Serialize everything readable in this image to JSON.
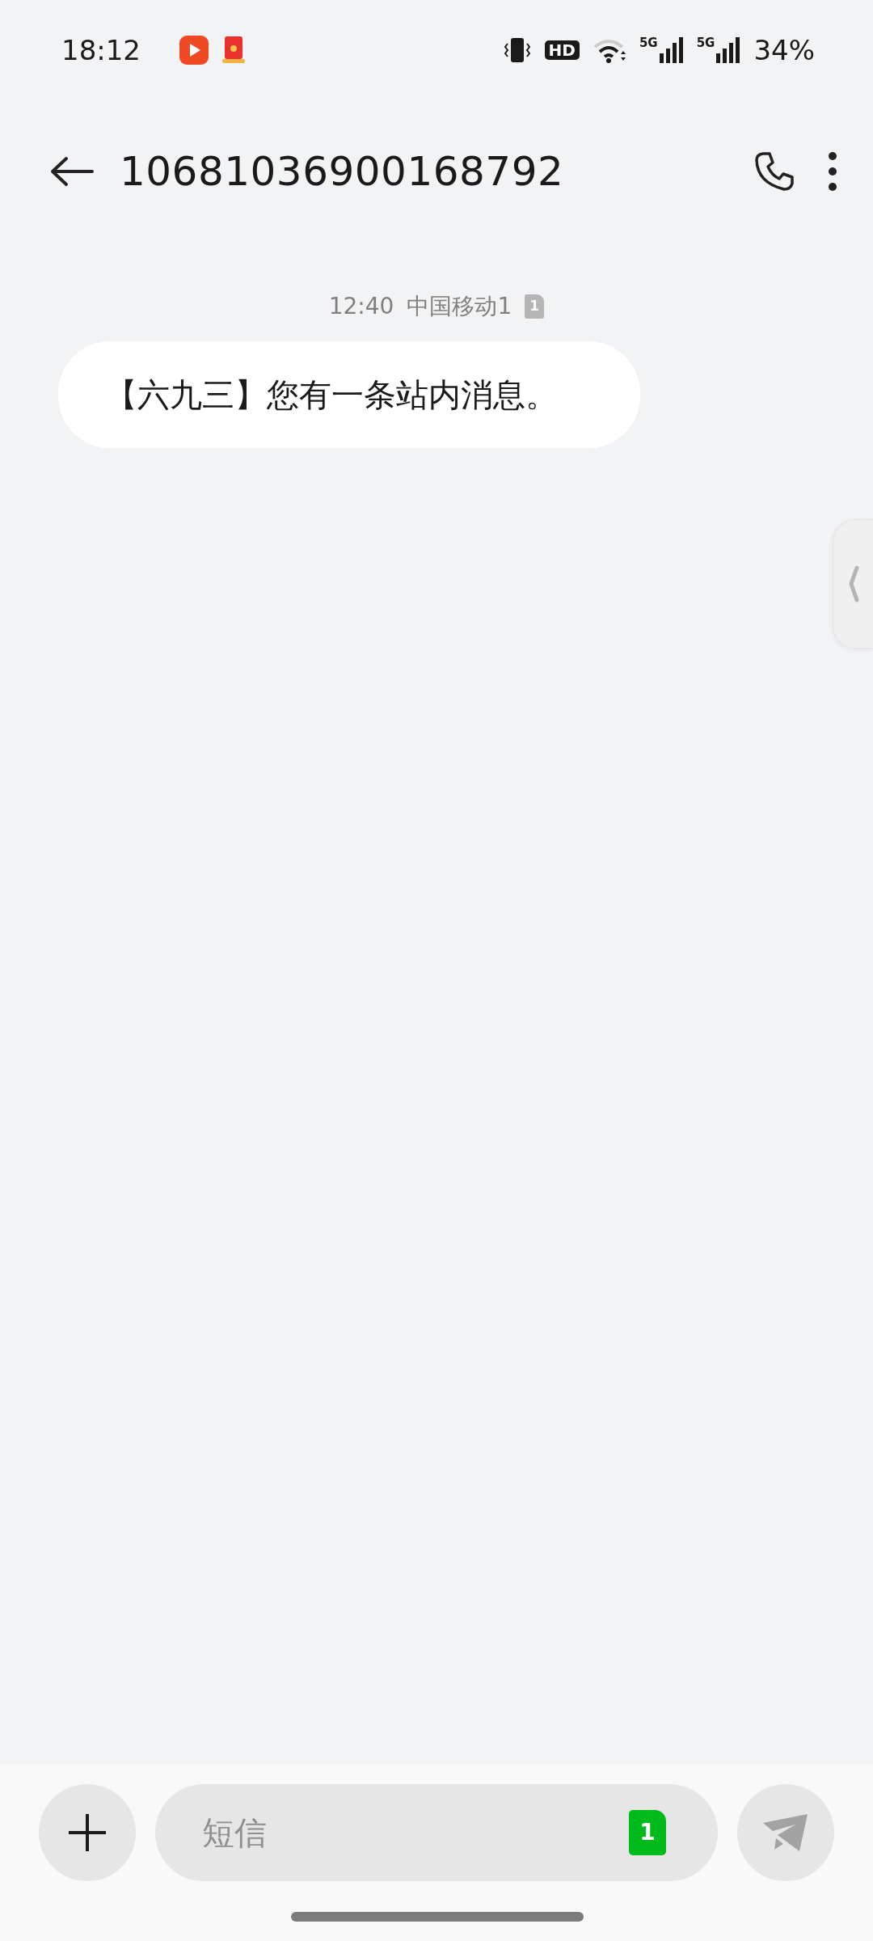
{
  "status_bar": {
    "time": "18:12",
    "hd_badge": "HD",
    "networks": [
      {
        "label": "5G"
      },
      {
        "label": "5G"
      }
    ],
    "battery": "34%"
  },
  "header": {
    "title": "10681036900168792"
  },
  "messages": [
    {
      "time": "12:40",
      "carrier": "中国移动1",
      "sim": "1",
      "text": "【六九三】您有一条站内消息。"
    }
  ],
  "composer": {
    "placeholder": "短信",
    "sim": "1"
  }
}
